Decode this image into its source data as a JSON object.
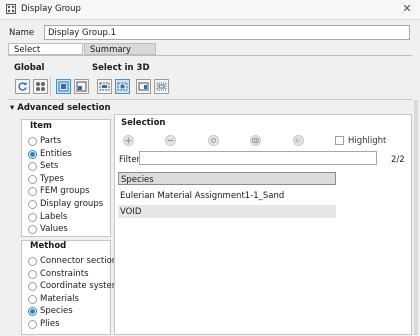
{
  "window": {
    "title": "Display Group",
    "icon": "display-group-icon",
    "close": "✕"
  },
  "name": {
    "label": "Name",
    "value": "Display Group.1"
  },
  "tabs": [
    {
      "label": "Select",
      "active": true
    },
    {
      "label": "Summary",
      "active": false
    }
  ],
  "toolbar": {
    "global_label": "Global",
    "select3d_label": "Select in 3D",
    "global_buttons": [
      "refresh-icon",
      "gear-cluster-icon"
    ],
    "select3d_buttons": [
      "select-single-icon",
      "select-box-icon",
      "select-region-icon",
      "select-inside-icon",
      "select-window-icon",
      "select-frame-icon"
    ]
  },
  "advanced": {
    "label": "Advanced selection",
    "arrow": "▾"
  },
  "item": {
    "label": "Item",
    "options": [
      "Parts",
      "Entities",
      "Sets",
      "Types",
      "FEM groups",
      "Display groups",
      "Labels",
      "Values"
    ],
    "selected": "Entities"
  },
  "method": {
    "label": "Method",
    "options": [
      "Connector sections",
      "Constraints",
      "Coordinate systems",
      "Materials",
      "Species",
      "Plies"
    ],
    "selected": "Species"
  },
  "selection": {
    "label": "Selection",
    "action_icons": [
      "add-icon",
      "remove-icon",
      "replace-icon",
      "intersect-icon",
      "exclusive-or-icon"
    ],
    "highlight_label": "Highlight",
    "highlight_checked": false,
    "filter_label": "Filter",
    "filter_value": "",
    "count": "2/2",
    "header": "Species",
    "rows": [
      "Eulerian Material Assignment1-1_Sand",
      "VOID"
    ]
  },
  "colors": {
    "accent": "#2f7fc4",
    "selected_tab": "#ffffff",
    "header_row": "#dcdcdc"
  }
}
